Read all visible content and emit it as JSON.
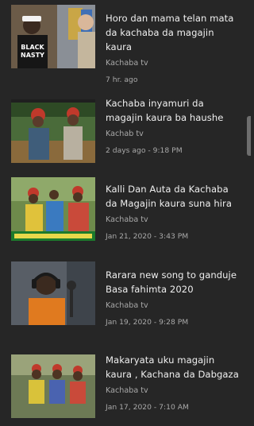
{
  "videos": [
    {
      "title": "Horo dan mama telan mata da kachaba da magajin kaura",
      "channel": "Kachaba tv",
      "date": "7 hr. ago",
      "thumb_label": "BLACK\nNASTY"
    },
    {
      "title": "Kachaba inyamuri da magajin kaura ba haushe",
      "channel": "Kachab tv",
      "date": "2 days ago - 9:18 PM",
      "thumb_label": ""
    },
    {
      "title": "Kalli Dan Auta da Kachaba da Magajin kaura suna hira",
      "channel": "Kachaba tv",
      "date": "Jan 21, 2020 - 3:43 PM",
      "thumb_label": ""
    },
    {
      "title": "Rarara new song to ganduje Basa fahimta 2020",
      "channel": "Kachaba tv",
      "date": "Jan 19, 2020 - 9:28 PM",
      "thumb_label": ""
    },
    {
      "title": "Makaryata uku magajin kaura , Kachana da Dabgaza",
      "channel": "Kachaba tv",
      "date": "Jan 17, 2020 - 7:10 AM",
      "thumb_label": ""
    }
  ]
}
